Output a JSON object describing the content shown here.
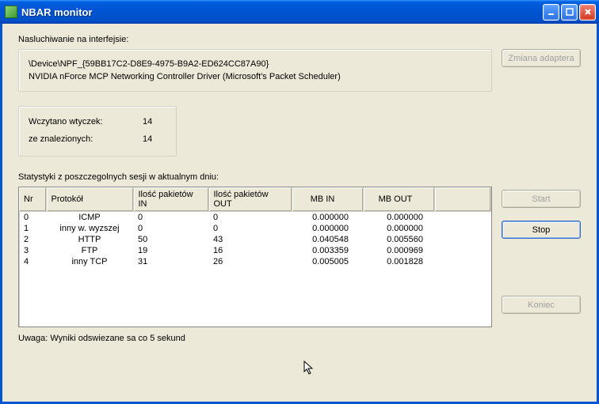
{
  "window": {
    "title": "NBAR monitor"
  },
  "interface": {
    "label": "Nasluchiwanie na interfejsie:",
    "device": "\\Device\\NPF_{59BB17C2-D8E9-4975-B9A2-ED624CC87A90}",
    "driver": "NVIDIA nForce MCP Networking Controller Driver (Microsoft's Packet Scheduler)"
  },
  "plugins": {
    "loaded_label": "Wczytano wtyczek:",
    "loaded_value": "14",
    "found_label": "ze znalezionych:",
    "found_value": "14"
  },
  "stats": {
    "label": "Statystyki z poszczegolnych sesji w aktualnym dniu:",
    "columns": {
      "nr": "Nr",
      "protocol": "Protokół",
      "pkt_in": "Ilość pakietów IN",
      "pkt_out": "Ilość pakietów OUT",
      "mb_in": "MB IN",
      "mb_out": "MB OUT"
    },
    "rows": [
      {
        "nr": "0",
        "protocol": "ICMP",
        "pkt_in": "0",
        "pkt_out": "0",
        "mb_in": "0.000000",
        "mb_out": "0.000000"
      },
      {
        "nr": "1",
        "protocol": "inny w. wyzszej",
        "pkt_in": "0",
        "pkt_out": "0",
        "mb_in": "0.000000",
        "mb_out": "0.000000"
      },
      {
        "nr": "2",
        "protocol": "HTTP",
        "pkt_in": "50",
        "pkt_out": "43",
        "mb_in": "0.040548",
        "mb_out": "0.005560"
      },
      {
        "nr": "3",
        "protocol": "FTP",
        "pkt_in": "19",
        "pkt_out": "16",
        "mb_in": "0.003359",
        "mb_out": "0.000969"
      },
      {
        "nr": "4",
        "protocol": "inny TCP",
        "pkt_in": "31",
        "pkt_out": "26",
        "mb_in": "0.005005",
        "mb_out": "0.001828"
      }
    ]
  },
  "buttons": {
    "change_adapter": "Zmiana adaptera",
    "start": "Start",
    "stop": "Stop",
    "end": "Koniec"
  },
  "note": "Uwaga: Wyniki odswiezane sa co 5 sekund"
}
